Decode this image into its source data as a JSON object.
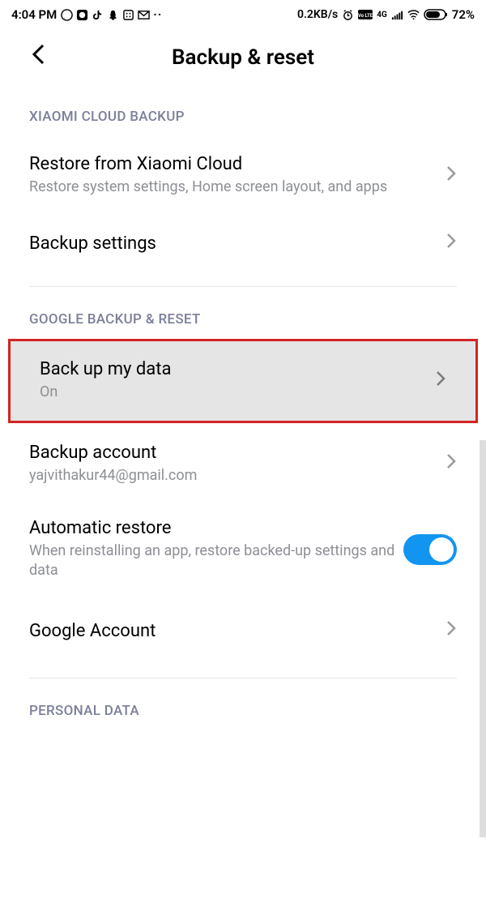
{
  "status": {
    "time": "4:04 PM",
    "speed": "0.2KB/s",
    "battery": "72%",
    "net_label": "4G"
  },
  "header": {
    "title": "Backup & reset"
  },
  "sections": {
    "xiaomi": {
      "label": "XIAOMI CLOUD BACKUP"
    },
    "google": {
      "label": "GOOGLE BACKUP & RESET"
    },
    "personal": {
      "label": "PERSONAL DATA"
    }
  },
  "rows": {
    "restore_cloud": {
      "title": "Restore from Xiaomi Cloud",
      "sub": "Restore system settings, Home screen layout, and apps"
    },
    "backup_settings": {
      "title": "Backup settings"
    },
    "backup_data": {
      "title": "Back up my data",
      "sub": "On"
    },
    "backup_account": {
      "title": "Backup account",
      "sub": "yajvithakur44@gmail.com"
    },
    "auto_restore": {
      "title": "Automatic restore",
      "sub": "When reinstalling an app, restore backed-up settings and data"
    },
    "google_account": {
      "title": "Google Account"
    }
  }
}
